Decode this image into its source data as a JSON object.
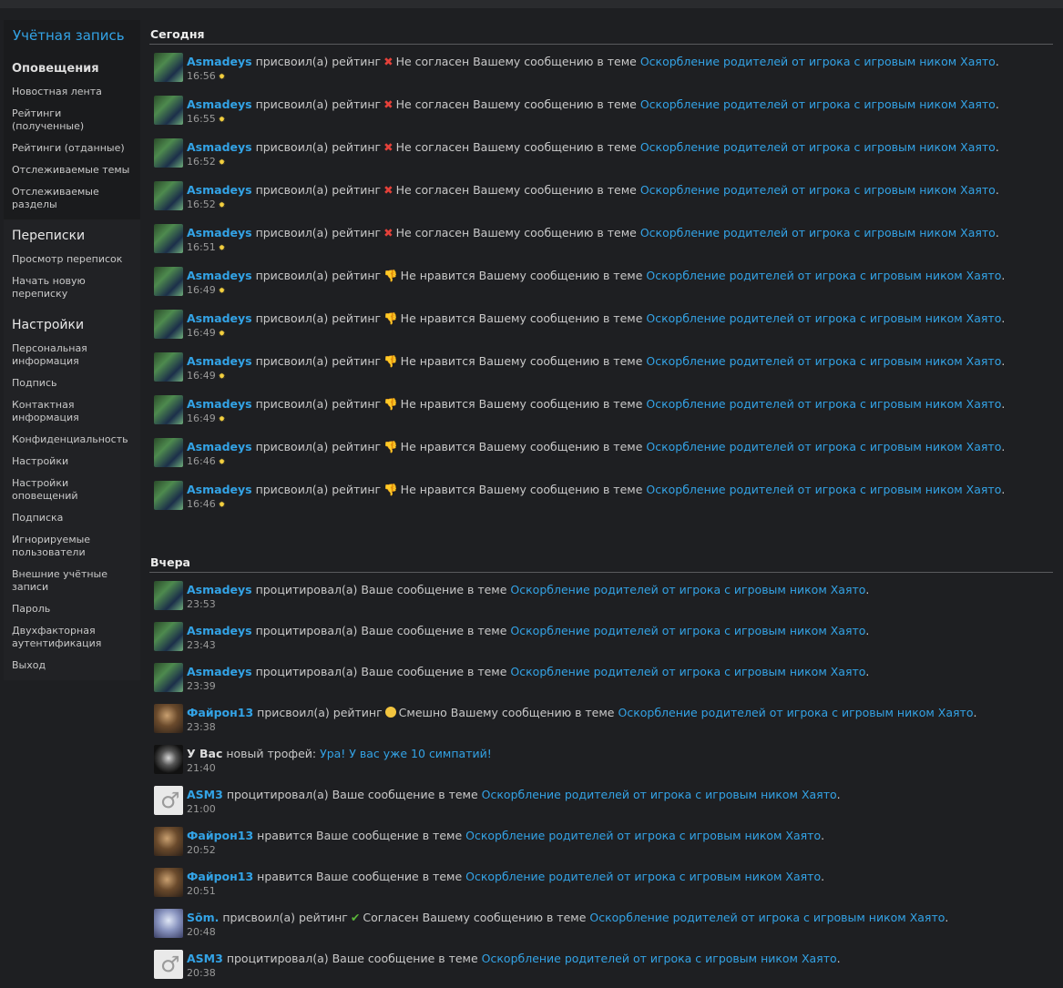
{
  "sidebar": {
    "title": "Учётная запись",
    "sections": [
      {
        "head": "Оповещения",
        "items": [
          "Новостная лента",
          "Рейтинги (полученные)",
          "Рейтинги (отданные)",
          "Отслеживаемые темы",
          "Отслеживаемые разделы"
        ]
      },
      {
        "head": "Переписки",
        "items": [
          "Просмотр переписок",
          "Начать новую переписку"
        ]
      },
      {
        "head": "Настройки",
        "items": [
          "Персональная информация",
          "Подпись",
          "Контактная информация",
          "Конфиденциальность",
          "Настройки",
          "Настройки оповещений",
          "Подписка",
          "Игнорируемые пользователи",
          "Внешние учётные записи",
          "Пароль",
          "Двухфакторная аутентификация",
          "Выход"
        ]
      }
    ]
  },
  "groups": [
    {
      "date": "Сегодня",
      "items": [
        {
          "user": "Asmadeys",
          "pre": "присвоил(а) рейтинг",
          "icon": "cross-icon",
          "rating": "Не согласен",
          "mid": "Вашему сообщению в теме",
          "link": "Оскорбление родителей от игрока с игровым ником Хаято",
          "post": ".",
          "time": "16:56",
          "avatar": "green"
        },
        {
          "user": "Asmadeys",
          "pre": "присвоил(а) рейтинг",
          "icon": "cross-icon",
          "rating": "Не согласен",
          "mid": "Вашему сообщению в теме",
          "link": "Оскорбление родителей от игрока с игровым ником Хаято",
          "post": ".",
          "time": "16:55",
          "avatar": "green"
        },
        {
          "user": "Asmadeys",
          "pre": "присвоил(а) рейтинг",
          "icon": "cross-icon",
          "rating": "Не согласен",
          "mid": "Вашему сообщению в теме",
          "link": "Оскорбление родителей от игрока с игровым ником Хаято",
          "post": ".",
          "time": "16:52",
          "avatar": "green"
        },
        {
          "user": "Asmadeys",
          "pre": "присвоил(а) рейтинг",
          "icon": "cross-icon",
          "rating": "Не согласен",
          "mid": "Вашему сообщению в теме",
          "link": "Оскорбление родителей от игрока с игровым ником Хаято",
          "post": ".",
          "time": "16:52",
          "avatar": "green"
        },
        {
          "user": "Asmadeys",
          "pre": "присвоил(а) рейтинг",
          "icon": "cross-icon",
          "rating": "Не согласен",
          "mid": "Вашему сообщению в теме",
          "link": "Оскорбление родителей от игрока с игровым ником Хаято",
          "post": ".",
          "time": "16:51",
          "avatar": "green"
        },
        {
          "user": "Asmadeys",
          "pre": "присвоил(а) рейтинг",
          "icon": "thumbs-down-icon",
          "rating": "Не нравится",
          "mid": "Вашему сообщению в теме",
          "link": "Оскорбление родителей от игрока с игровым ником Хаято",
          "post": ".",
          "time": "16:49",
          "avatar": "green"
        },
        {
          "user": "Asmadeys",
          "pre": "присвоил(а) рейтинг",
          "icon": "thumbs-down-icon",
          "rating": "Не нравится",
          "mid": "Вашему сообщению в теме",
          "link": "Оскорбление родителей от игрока с игровым ником Хаято",
          "post": ".",
          "time": "16:49",
          "avatar": "green"
        },
        {
          "user": "Asmadeys",
          "pre": "присвоил(а) рейтинг",
          "icon": "thumbs-down-icon",
          "rating": "Не нравится",
          "mid": "Вашему сообщению в теме",
          "link": "Оскорбление родителей от игрока с игровым ником Хаято",
          "post": ".",
          "time": "16:49",
          "avatar": "green"
        },
        {
          "user": "Asmadeys",
          "pre": "присвоил(а) рейтинг",
          "icon": "thumbs-down-icon",
          "rating": "Не нравится",
          "mid": "Вашему сообщению в теме",
          "link": "Оскорбление родителей от игрока с игровым ником Хаято",
          "post": ".",
          "time": "16:49",
          "avatar": "green"
        },
        {
          "user": "Asmadeys",
          "pre": "присвоил(а) рейтинг",
          "icon": "thumbs-down-icon",
          "rating": "Не нравится",
          "mid": "Вашему сообщению в теме",
          "link": "Оскорбление родителей от игрока с игровым ником Хаято",
          "post": ".",
          "time": "16:46",
          "avatar": "green"
        },
        {
          "user": "Asmadeys",
          "pre": "присвоил(а) рейтинг",
          "icon": "thumbs-down-icon",
          "rating": "Не нравится",
          "mid": "Вашему сообщению в теме",
          "link": "Оскорбление родителей от игрока с игровым ником Хаято",
          "post": ".",
          "time": "16:46",
          "avatar": "green"
        }
      ]
    },
    {
      "date": "Вчера",
      "items": [
        {
          "user": "Asmadeys",
          "pre": "процитировал(а) Ваше сообщение в теме",
          "link": "Оскорбление родителей от игрока с игровым ником Хаято",
          "post": ".",
          "time": "23:53",
          "avatar": "green"
        },
        {
          "user": "Asmadeys",
          "pre": "процитировал(а) Ваше сообщение в теме",
          "link": "Оскорбление родителей от игрока с игровым ником Хаято",
          "post": ".",
          "time": "23:43",
          "avatar": "green"
        },
        {
          "user": "Asmadeys",
          "pre": "процитировал(а) Ваше сообщение в теме",
          "link": "Оскорбление родителей от игрока с игровым ником Хаято",
          "post": ".",
          "time": "23:39",
          "avatar": "green"
        },
        {
          "user": "Файрон13",
          "pre": "присвоил(а) рейтинг",
          "icon": "smile-icon",
          "rating": "Смешно",
          "mid": "Вашему сообщению в теме",
          "link": "Оскорбление родителей от игрока с игровым ником Хаято",
          "post": ".",
          "time": "23:38",
          "avatar": "brown"
        },
        {
          "plainbold": "У Вас",
          "pre": "новый трофей:",
          "link": "Ура! У вас уже 10 симпатий!",
          "post": "",
          "time": "21:40",
          "avatar": "dark"
        },
        {
          "user": "ASM3",
          "pre": "процитировал(а) Ваше сообщение в теме",
          "link": "Оскорбление родителей от игрока с игровым ником Хаято",
          "post": ".",
          "time": "21:00",
          "avatar": "white"
        },
        {
          "user": "Файрон13",
          "pre": "нравится Ваше сообщение в теме",
          "link": "Оскорбление родителей от игрока с игровым ником Хаято",
          "post": ".",
          "time": "20:52",
          "avatar": "brown"
        },
        {
          "user": "Файрон13",
          "pre": "нравится Ваше сообщение в теме",
          "link": "Оскорбление родителей от игрока с игровым ником Хаято",
          "post": ".",
          "time": "20:51",
          "avatar": "brown"
        },
        {
          "user": "Sõm.",
          "pre": "присвоил(а) рейтинг",
          "icon": "check-icon",
          "rating": "Согласен",
          "mid": "Вашему сообщению в теме",
          "link": "Оскорбление родителей от игрока с игровым ником Хаято",
          "post": ".",
          "time": "20:48",
          "avatar": "ice"
        },
        {
          "user": "ASM3",
          "pre": "процитировал(а) Ваше сообщение в теме",
          "link": "Оскорбление родителей от игрока с игровым ником Хаято",
          "post": ".",
          "time": "20:38",
          "avatar": "white"
        }
      ]
    }
  ]
}
